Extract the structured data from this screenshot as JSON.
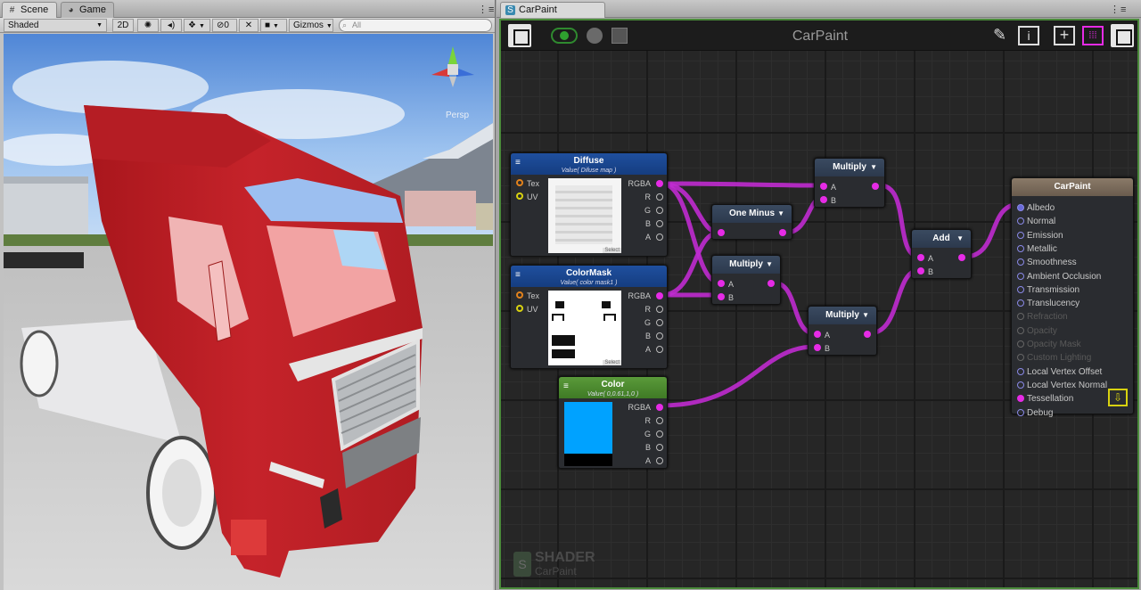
{
  "scene": {
    "tabs": [
      {
        "label": "Scene",
        "icon": "scene-grid-icon"
      },
      {
        "label": "Game",
        "icon": "game-pacman-icon"
      }
    ],
    "toolbar": {
      "shading_mode": "Shaded",
      "view_mode": "2D",
      "hidden_count": "0",
      "gizmos_label": "Gizmos",
      "search_placeholder": "All"
    },
    "camera_label": "Persp"
  },
  "shader_editor": {
    "tab_label": "CarPaint",
    "title": "CarPaint",
    "watermark_title": "SHADER",
    "watermark_name": "CarPaint",
    "nodes": {
      "diffuse": {
        "title": "Diffuse",
        "subtitle": "Value( Difuse map )",
        "inputs": [
          "Tex",
          "UV"
        ],
        "outputs": [
          "RGBA",
          "R",
          "G",
          "B",
          "A"
        ],
        "select_label": "Select"
      },
      "colormask": {
        "title": "ColorMask",
        "subtitle": "Value( color mask1 )",
        "inputs": [
          "Tex",
          "UV"
        ],
        "outputs": [
          "RGBA",
          "R",
          "G",
          "B",
          "A"
        ],
        "select_label": "Select"
      },
      "color": {
        "title": "Color",
        "subtitle": "Value( 0,0.61,1,0 )",
        "swatch": "#00a2ff",
        "outputs": [
          "RGBA",
          "R",
          "G",
          "B",
          "A"
        ]
      },
      "one_minus": {
        "title": "One Minus"
      },
      "multiply1": {
        "title": "Multiply",
        "inputs": [
          "A",
          "B"
        ]
      },
      "multiply2": {
        "title": "Multiply",
        "inputs": [
          "A",
          "B"
        ]
      },
      "multiply3": {
        "title": "Multiply",
        "inputs": [
          "A",
          "B"
        ]
      },
      "add": {
        "title": "Add",
        "inputs": [
          "A",
          "B"
        ]
      },
      "master": {
        "title": "CarPaint",
        "inputs": [
          {
            "label": "Albedo",
            "state": "connected"
          },
          {
            "label": "Normal",
            "state": "active"
          },
          {
            "label": "Emission",
            "state": "active"
          },
          {
            "label": "Metallic",
            "state": "active"
          },
          {
            "label": "Smoothness",
            "state": "active"
          },
          {
            "label": "Ambient Occlusion",
            "state": "active"
          },
          {
            "label": "Transmission",
            "state": "active"
          },
          {
            "label": "Translucency",
            "state": "active"
          },
          {
            "label": "Refraction",
            "state": "disabled"
          },
          {
            "label": "Opacity",
            "state": "disabled"
          },
          {
            "label": "Opacity Mask",
            "state": "disabled"
          },
          {
            "label": "Custom Lighting",
            "state": "disabled"
          },
          {
            "label": "Local Vertex Offset",
            "state": "active"
          },
          {
            "label": "Local Vertex Normal",
            "state": "active"
          },
          {
            "label": "Tessellation",
            "state": "pink"
          },
          {
            "label": "Debug",
            "state": "active"
          }
        ]
      }
    },
    "colors": {
      "wire": "#c02bd0",
      "frame_border": "#4a8a3a",
      "accent_pink": "#e62be6"
    }
  }
}
